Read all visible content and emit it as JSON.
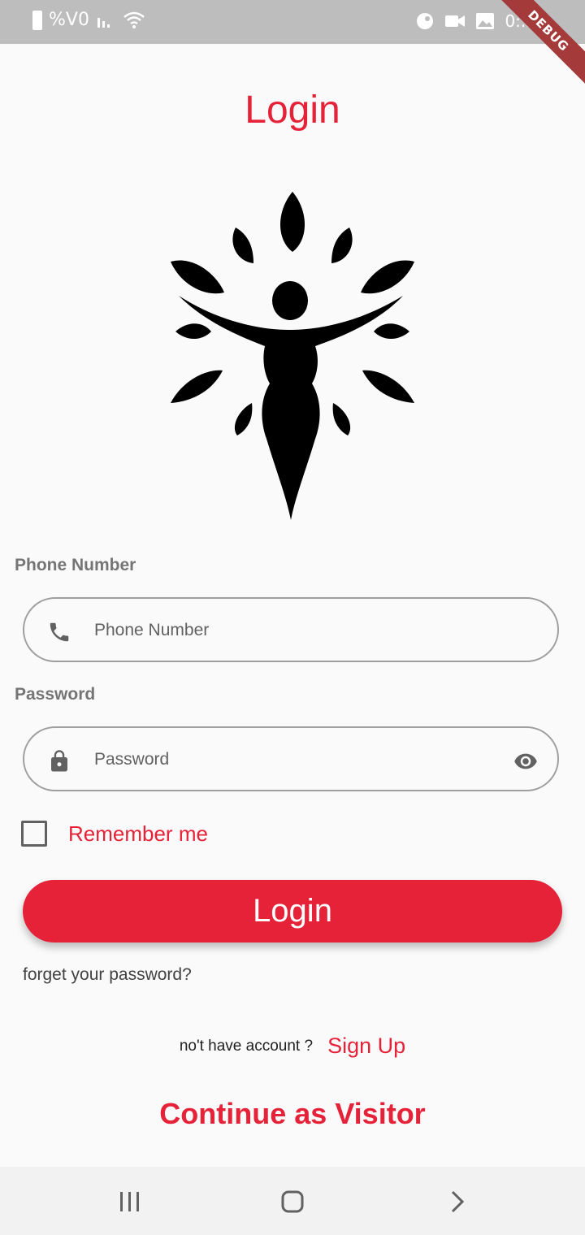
{
  "status_bar": {
    "left_text": "%V0",
    "time": "0:..."
  },
  "debug_badge": "DEBUG",
  "title": "Login",
  "phone": {
    "label": "Phone Number",
    "placeholder": "Phone Number",
    "icon": "phone-icon"
  },
  "password": {
    "label": "Password",
    "placeholder": "Password",
    "icon": "lock-icon",
    "toggle_icon": "eye-icon"
  },
  "remember_me": {
    "label": "Remember me",
    "checked": false
  },
  "login_button": "Login",
  "forget_password": "forget your password?",
  "signup": {
    "prompt": "no't have account ?",
    "link": "Sign Up"
  },
  "continue_visitor": "Continue as Visitor",
  "colors": {
    "accent": "#e52238",
    "text_gray": "#757575"
  }
}
